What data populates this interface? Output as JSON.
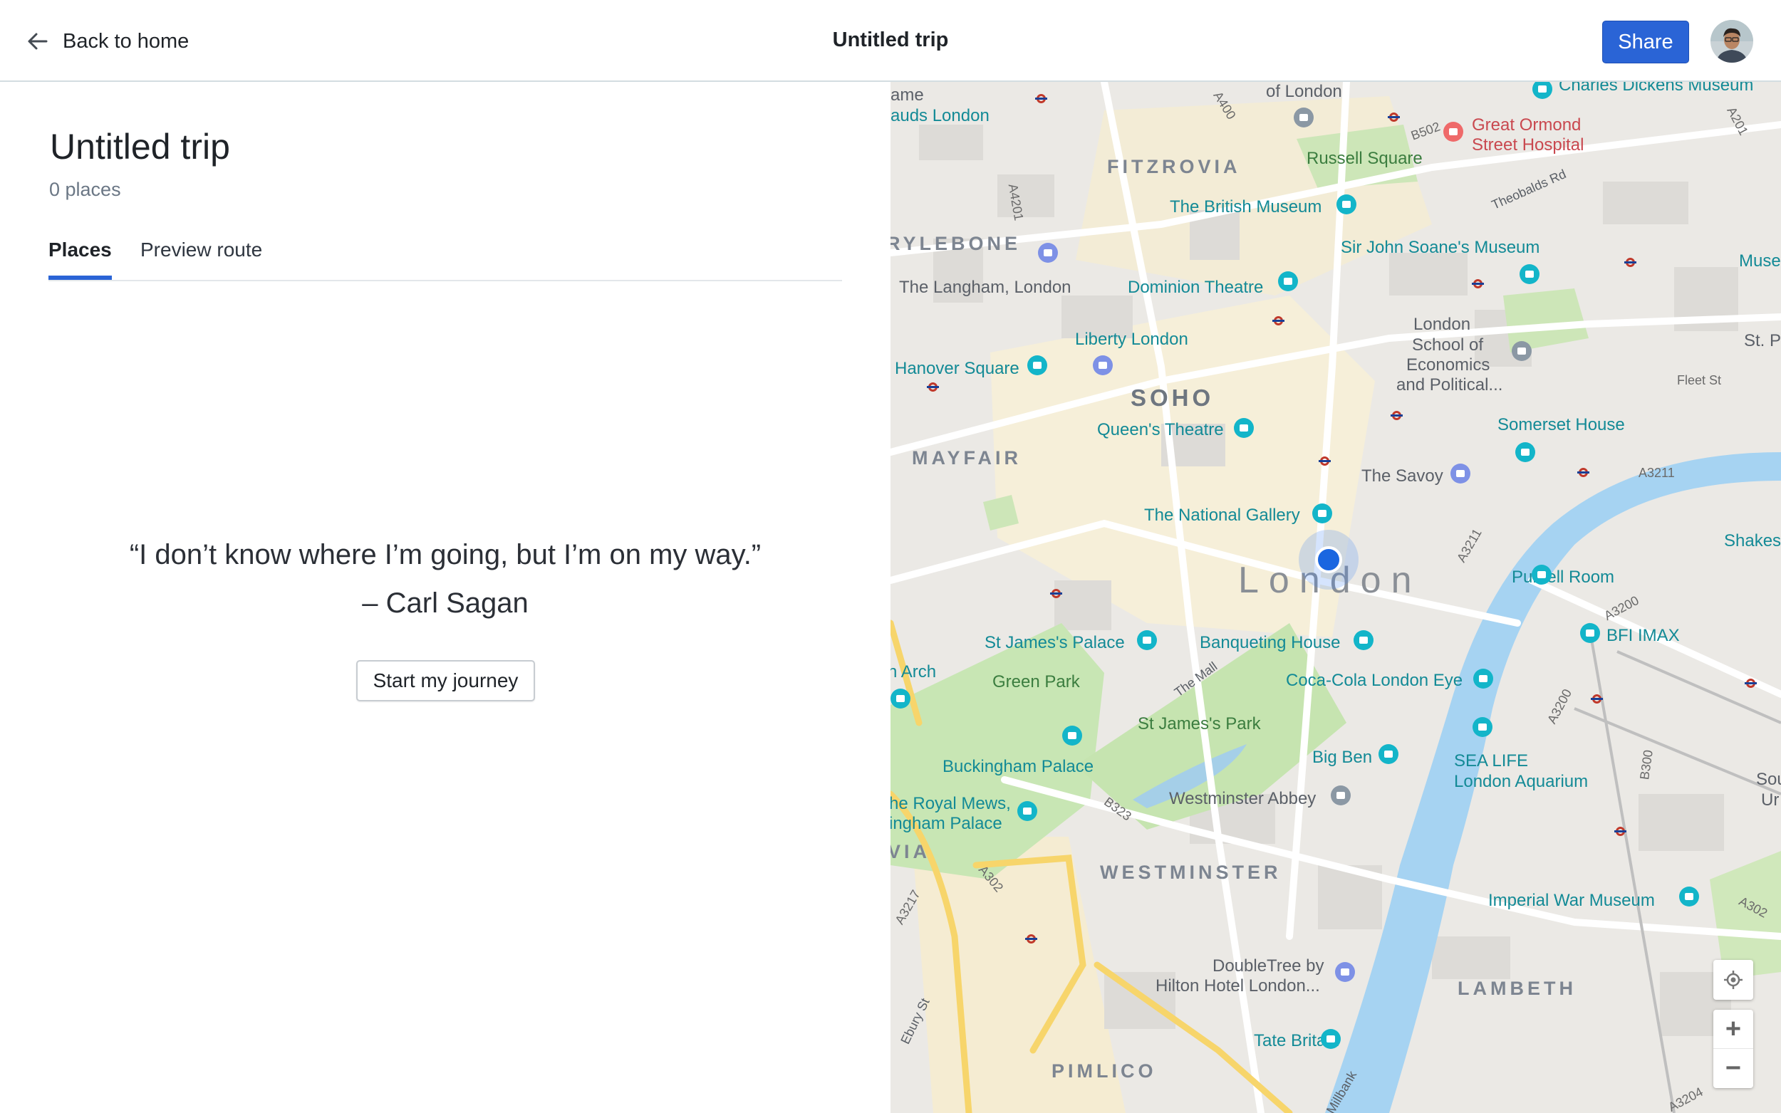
{
  "header": {
    "back_label": "Back to home",
    "title": "Untitled trip",
    "share_label": "Share"
  },
  "trip": {
    "title": "Untitled trip",
    "places_count": "0 places"
  },
  "tabs": [
    {
      "label": "Places",
      "active": true
    },
    {
      "label": "Preview route",
      "active": false
    }
  ],
  "empty_state": {
    "quote": "“I don’t know where I’m going, but I’m on my way.”",
    "author": "– Carl Sagan",
    "button_label": "Start my journey"
  },
  "map": {
    "city_label": "London",
    "districts": [
      "FITZROVIA",
      "RYLEBONE",
      "SOHO",
      "MAYFAIR",
      "WESTMINSTER",
      "LAMBETH",
      "PIMLICO",
      "VIA"
    ],
    "places": {
      "of_london": "of London",
      "ame": "ame",
      "auds_london": "auds London",
      "great_ormond_1": "Great Ormond",
      "great_ormond_2": "Street Hospital",
      "charles_dickens": "Charles Dickens Museum",
      "russell_square": "Russell Square",
      "british_museum": "The British Museum",
      "sir_john_soane": "Sir John Soane's Museum",
      "museu": "Museu",
      "langham": "The Langham, London",
      "dominion": "Dominion Theatre",
      "lse_1": "London",
      "lse_2": "School of",
      "lse_3": "Economics",
      "lse_4": "and Political...",
      "st_p": "St. P",
      "liberty": "Liberty London",
      "hanover": "Hanover Square",
      "queens": "Queen's Theatre",
      "somerset": "Somerset House",
      "savoy": "The Savoy",
      "national_gallery": "The National Gallery",
      "shakesp": "Shakesp",
      "purcell": "Purcell Room",
      "bfi": "BFI IMAX",
      "arch": "n Arch",
      "st_james_palace": "St James's Palace",
      "banqueting": "Banqueting House",
      "green_park": "Green Park",
      "coca_cola": "Coca-Cola London Eye",
      "st_james_park": "St James's Park",
      "big_ben": "Big Ben",
      "sea_life_1": "SEA LIFE",
      "sea_life_2": "London Aquarium",
      "buckingham": "Buckingham Palace",
      "royal_mews_1": "he Royal Mews,",
      "royal_mews_2": "ingham Palace",
      "westminster_abbey": "Westminster Abbey",
      "sou_1": "Sou",
      "sou_2": "Ur",
      "imperial_war": "Imperial War Museum",
      "doubletree_1": "DoubleTree by",
      "doubletree_2": "Hilton Hotel London...",
      "tate": "Tate Britain"
    },
    "roads": {
      "a400": "A400",
      "b502": "B502",
      "a201": "A201",
      "a4201": "A4201",
      "theobalds": "Theobalds Rd",
      "fleet": "Fleet St",
      "a3211": "A3211",
      "a3211b": "A3211",
      "a3200": "A3200",
      "a3200b": "A3200",
      "the_mall": "The Mall",
      "b323": "B323",
      "a302": "A302",
      "a3217": "A3217",
      "b300": "B300",
      "a302b": "A302",
      "ebury": "Ebury St",
      "millbank": "Millbank",
      "a3204": "A3204"
    },
    "controls": {
      "zoom_in": "+",
      "zoom_out": "−"
    }
  }
}
